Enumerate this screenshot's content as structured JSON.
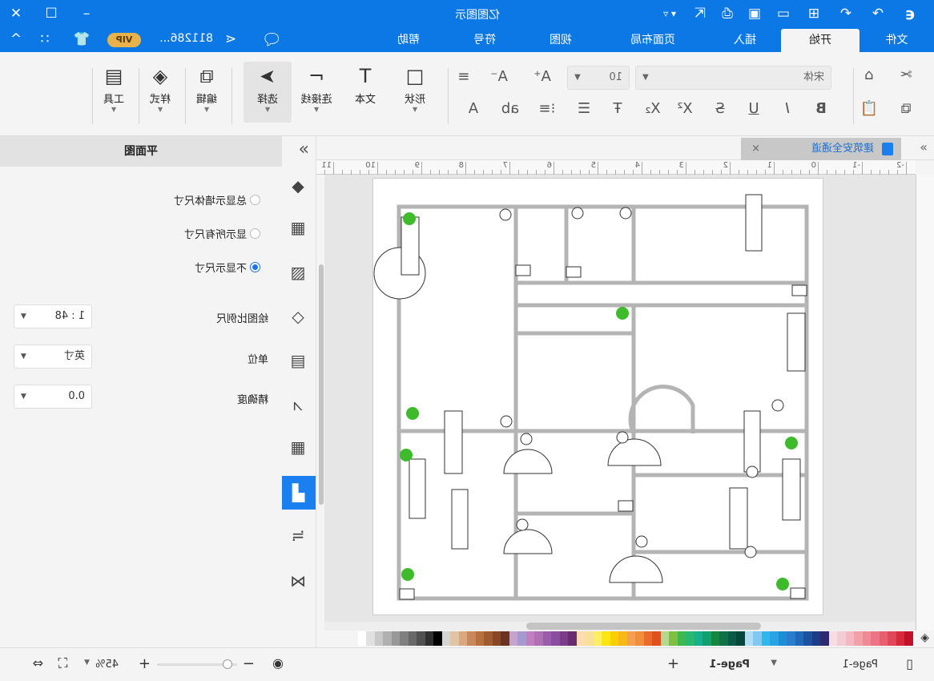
{
  "app": {
    "title": "亿图图示",
    "user": "811286...",
    "vip": "VIP"
  },
  "tabs": [
    {
      "label": "文件"
    },
    {
      "label": "开始"
    },
    {
      "label": "插入"
    },
    {
      "label": "页面布局"
    },
    {
      "label": "视图"
    },
    {
      "label": "符号"
    },
    {
      "label": "帮助"
    }
  ],
  "active_tab": "开始",
  "ribbon": {
    "font": "宋体",
    "size": "10",
    "tools": [
      {
        "label": "形状",
        "icon": "□"
      },
      {
        "label": "文本",
        "icon": "T"
      },
      {
        "label": "连接线",
        "icon": "⌐"
      },
      {
        "label": "选择",
        "icon": "➤"
      },
      {
        "label": "编辑",
        "icon": "⧉"
      },
      {
        "label": "样式",
        "icon": "◈"
      },
      {
        "label": "工具",
        "icon": "▤"
      }
    ]
  },
  "doc_tab": {
    "title": "建筑安全通道"
  },
  "ruler": [
    "-2",
    "-1",
    "0",
    "1",
    "2",
    "3",
    "4",
    "5",
    "6",
    "7",
    "8",
    "9",
    "10",
    "11"
  ],
  "panel": {
    "title": "平面图",
    "radios": [
      {
        "label": "总显示墙体尺寸",
        "checked": false
      },
      {
        "label": "显示所有尺寸",
        "checked": false
      },
      {
        "label": "不显示尺寸",
        "checked": true
      }
    ],
    "fields": [
      {
        "label": "绘图比例尺",
        "value": "1 : 48"
      },
      {
        "label": "单位",
        "value": "英寸"
      },
      {
        "label": "精确度",
        "value": "0.0"
      }
    ]
  },
  "status": {
    "page_tab": "Page-1",
    "current_page": "Page-1",
    "zoom": "45%",
    "zoom_level": 45
  },
  "colors": {
    "accent": "#0b78e6",
    "wall": "#b4b4b4"
  },
  "palette": [
    "#c0102a",
    "#d8283c",
    "#e0485a",
    "#e86070",
    "#ec7486",
    "#f08a96",
    "#f4a0a8",
    "#f4b8c0",
    "#f0ccd4",
    "#f8dce4",
    "#2e2a70",
    "#1c3c88",
    "#1e50a0",
    "#2068b8",
    "#2a7ccc",
    "#1c8ed8",
    "#28a4e4",
    "#30b8ee",
    "#80c8f0",
    "#b0dcf4",
    "#04483c",
    "#0a5a48",
    "#107048",
    "#14883e",
    "#10a070",
    "#16b08c",
    "#28b870",
    "#40b850",
    "#80c040",
    "#b4d890",
    "#e0501c",
    "#ea6a2c",
    "#f08e3c",
    "#f4a050",
    "#f8b818",
    "#fcd000",
    "#fce610",
    "#fcee60",
    "#f8e098",
    "#fcdcb0",
    "#6a2c70",
    "#7c3c88",
    "#8a4ea0",
    "#9c5cac",
    "#b070b4",
    "#c080c0",
    "#a898d0",
    "#c4a4cc",
    "#6a3420",
    "#884828",
    "#a05c30",
    "#b87040",
    "#c8885c",
    "#d8a880",
    "#e0c4a4",
    "#d4d4d4",
    "#000000",
    "#303030",
    "#505050",
    "#686868",
    "#808080",
    "#989898",
    "#b0b0b0",
    "#c8c8c8",
    "#e0e0e0",
    "#ffffff"
  ]
}
